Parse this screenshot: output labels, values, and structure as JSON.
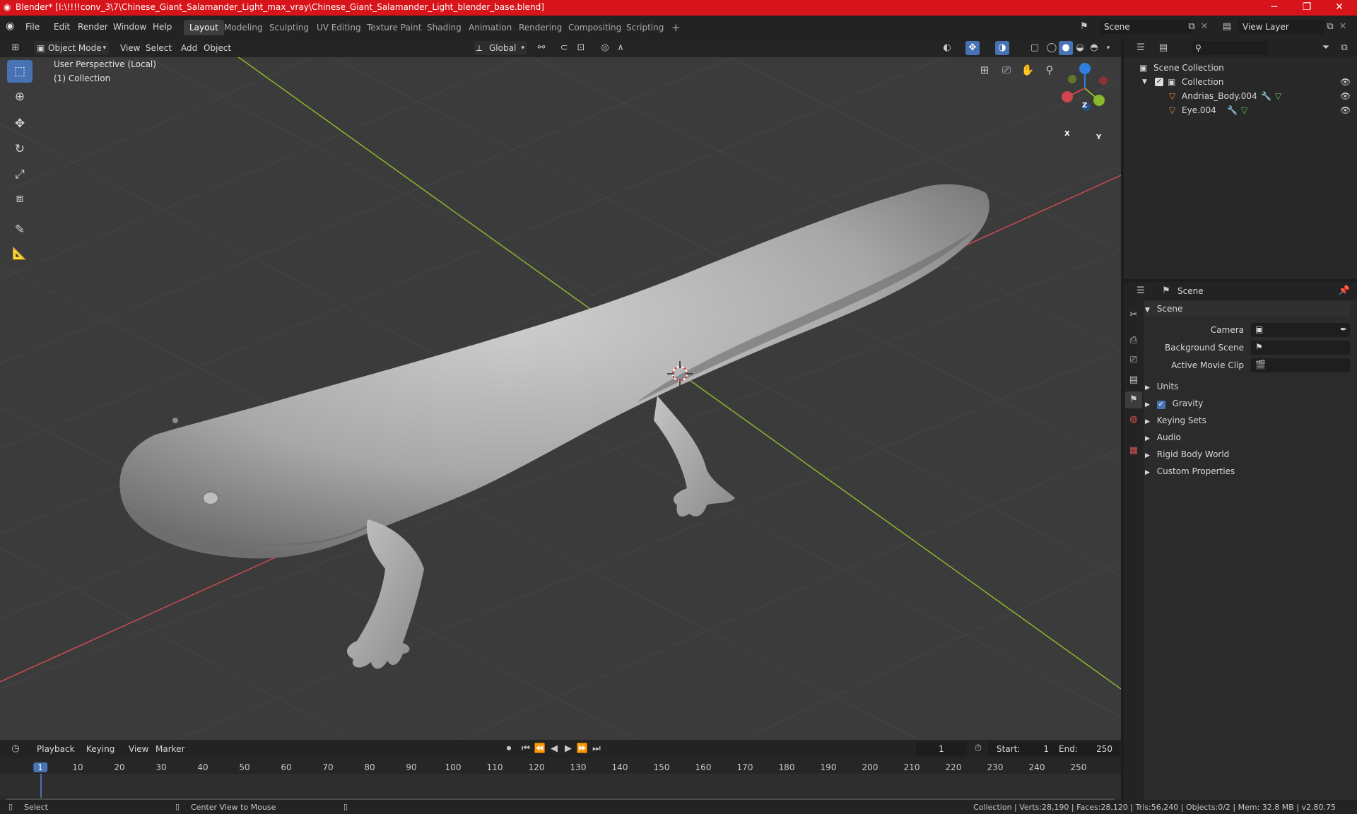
{
  "window": {
    "title": "Blender* [I:\\!!!!conv_3\\7\\Chinese_Giant_Salamander_Light_max_vray\\Chinese_Giant_Salamander_Light_blender_base.blend]",
    "minimize": "─",
    "maximize": "❐",
    "close": "✕"
  },
  "menu": [
    "File",
    "Edit",
    "Render",
    "Window",
    "Help"
  ],
  "workspaces": [
    "Layout",
    "Modeling",
    "Sculpting",
    "UV Editing",
    "Texture Paint",
    "Shading",
    "Animation",
    "Rendering",
    "Compositing",
    "Scripting"
  ],
  "scene_field": "Scene",
  "view_layer_field": "View Layer",
  "viewport": {
    "mode": "Object Mode",
    "menus": [
      "View",
      "Select",
      "Add",
      "Object"
    ],
    "transform_orientation": "Global",
    "overlay_line1": "User Perspective (Local)",
    "overlay_line2": "(1) Collection",
    "gizmo": {
      "z": "Z",
      "y": "Y",
      "x": "X"
    }
  },
  "outliner": {
    "root": "Scene Collection",
    "collection": "Collection",
    "objects": [
      "Andrias_Body.004",
      "Eye.004"
    ]
  },
  "properties": {
    "context": "Scene",
    "section": "Scene",
    "fields": [
      "Camera",
      "Background Scene",
      "Active Movie Clip"
    ],
    "panels": [
      "Units",
      "Gravity",
      "Keying Sets",
      "Audio",
      "Rigid Body World",
      "Custom Properties"
    ]
  },
  "timeline": {
    "menus": [
      "Playback",
      "Keying",
      "View",
      "Marker"
    ],
    "current_frame": "1",
    "start_label": "Start:",
    "start": "1",
    "end_label": "End:",
    "end": "250",
    "ticks": [
      "1",
      "10",
      "20",
      "30",
      "40",
      "50",
      "60",
      "70",
      "80",
      "90",
      "100",
      "110",
      "120",
      "130",
      "140",
      "150",
      "160",
      "170",
      "180",
      "190",
      "200",
      "210",
      "220",
      "230",
      "240",
      "250"
    ]
  },
  "status": {
    "left_action": "Select",
    "middle_action": "Center View to Mouse",
    "stats": "Collection | Verts:28,190 | Faces:28,120 | Tris:56,240 | Objects:0/2 | Mem: 32.8 MB | v2.80.75"
  },
  "colors": {
    "title_bar": "#d8141b",
    "accent": "#4772b3",
    "axis_x": "#c94c52",
    "axis_y": "#8ab82c"
  }
}
